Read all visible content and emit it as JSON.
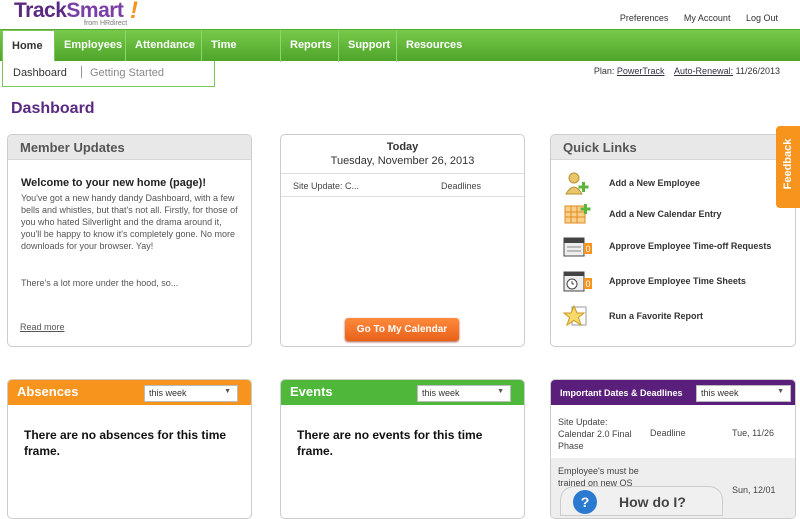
{
  "logo": {
    "part1": "Track",
    "part2": "Smart",
    "bang": "!",
    "sub": "from HRdirect"
  },
  "top_links": [
    "Preferences",
    "My Account",
    "Log Out"
  ],
  "nav": {
    "items": [
      "Home",
      "Employees",
      "Attendance",
      "Time Sheets",
      "Reports",
      "Support",
      "Resources"
    ],
    "active": "Home"
  },
  "subnav": {
    "items": [
      "Dashboard",
      "Getting Started"
    ]
  },
  "plan": {
    "plan_label": "Plan:",
    "plan_value": "PowerTrack",
    "renewal_label": "Auto-Renewal:",
    "renewal_value": "11/26/2013"
  },
  "page_title": "Dashboard",
  "member_updates": {
    "header": "Member Updates",
    "title": "Welcome to your new home (page)!",
    "body": "You've got a new handy dandy Dashboard, with a few bells and whistles, but that's not all. Firstly, for those of you who hated Silverlight and the drama around it, you'll be happy to know it's completely gone. No more downloads for your browser. Yay!",
    "more": "There's a lot more under the hood, so...",
    "read_more": "Read more"
  },
  "today": {
    "title": "Today",
    "date": "Tuesday, November 26, 2013",
    "col1": "Site Update: C...",
    "col2": "Deadlines",
    "button": "Go To My Calendar"
  },
  "quick_links": {
    "header": "Quick Links",
    "items": [
      {
        "label": "Add a New Employee",
        "icon": "add-employee-icon"
      },
      {
        "label": "Add a New Calendar Entry",
        "icon": "add-calendar-icon"
      },
      {
        "label": "Approve Employee Time-off Requests",
        "icon": "time-off-icon"
      },
      {
        "label": "Approve Employee Time Sheets",
        "icon": "time-sheet-icon"
      },
      {
        "label": "Run a Favorite Report",
        "icon": "favorite-report-icon"
      }
    ]
  },
  "feedback": "Feedback",
  "absences": {
    "header": "Absences",
    "select": "this week",
    "message": "There are no absences for this time frame."
  },
  "events": {
    "header": "Events",
    "select": "this week",
    "message": "There are no events for this time frame."
  },
  "important_dates": {
    "header": "Important Dates & Deadlines",
    "select": "this week",
    "rows": [
      {
        "text": "Site Update: Calendar 2.0 Final Phase",
        "type": "Deadline",
        "date": "Tue, 11/26"
      },
      {
        "text": "Employee's must be trained on new OS",
        "type": "",
        "date": "Sun, 12/01"
      }
    ]
  },
  "help": {
    "label": "How do I?",
    "icon": "?"
  },
  "colors": {
    "nav_green": "#4fa52a",
    "brand_purple": "#5a2a82",
    "orange": "#f7941d",
    "events_green": "#4fb83a",
    "dates_purple": "#5a1f7a"
  }
}
